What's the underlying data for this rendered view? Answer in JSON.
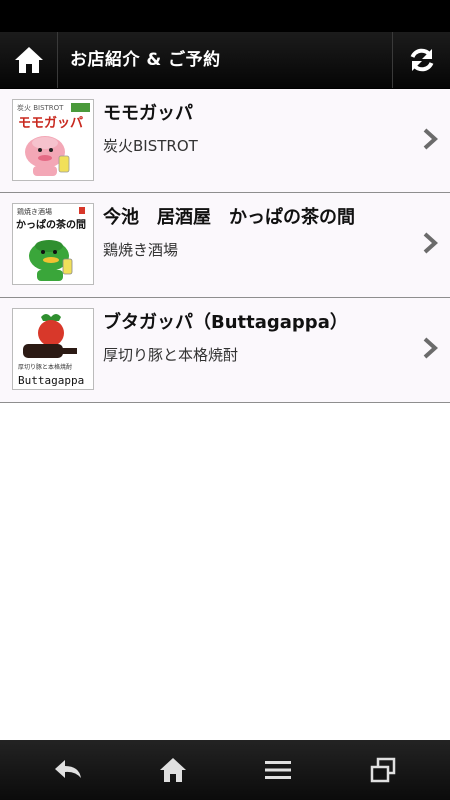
{
  "header": {
    "title": "お店紹介 & ご予約",
    "home_icon": "home-icon",
    "refresh_icon": "refresh-icon"
  },
  "shops": [
    {
      "name": "モモガッパ",
      "subtitle": "炭火BISTROT",
      "thumb_text_top": "炭火 BISTROT",
      "thumb_text_main": "モモガッパ"
    },
    {
      "name": "今池　居酒屋　かっぱの茶の間",
      "subtitle": "鶏焼き酒場",
      "thumb_text_top": "鶏焼き酒場",
      "thumb_text_main": "かっぱの茶の間"
    },
    {
      "name": "ブタガッパ（Buttagappa）",
      "subtitle": "厚切り豚と本格焼酎",
      "thumb_text_top": "厚切り豚と本格焼酎",
      "thumb_text_main": "Buttagappa"
    }
  ],
  "navbar": {
    "icons": [
      "back-icon",
      "home-icon",
      "menu-icon",
      "recent-apps-icon"
    ]
  },
  "colors": {
    "header_bg": "#0f0f0f",
    "row_bg": "#fbf8fc",
    "divider": "#8e8e8e",
    "chevron": "#6b6b6b",
    "kappa_green": "#3aa63a",
    "accent_red": "#d8382a"
  }
}
